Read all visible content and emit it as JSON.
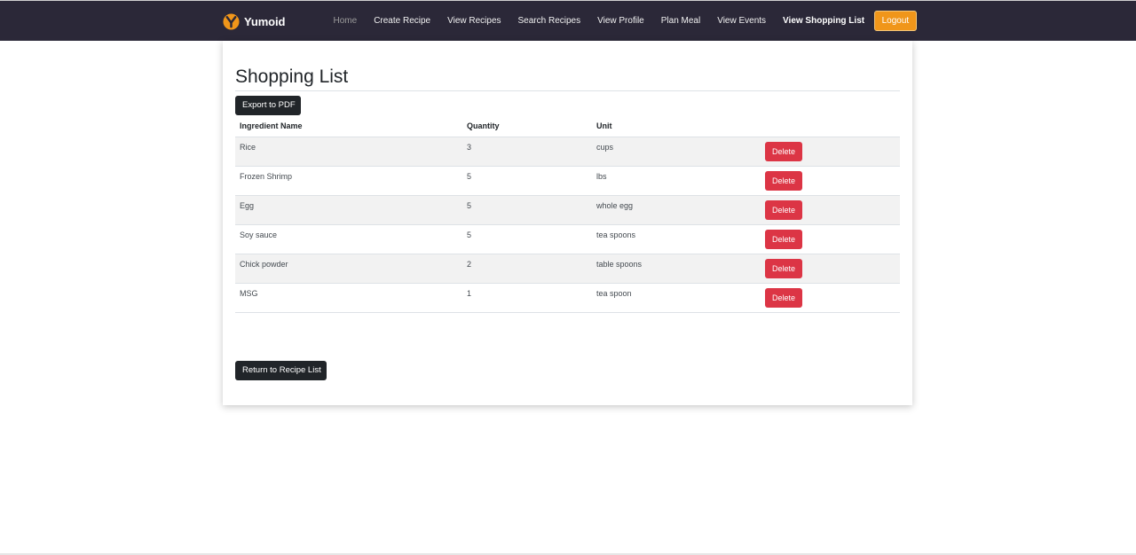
{
  "nav": {
    "brand": "Yumoid",
    "links": [
      {
        "label": "Home"
      },
      {
        "label": "Create Recipe"
      },
      {
        "label": "View Recipes"
      },
      {
        "label": "Search Recipes"
      },
      {
        "label": "View Profile"
      },
      {
        "label": "Plan Meal"
      },
      {
        "label": "View Events"
      },
      {
        "label": "View Shopping List"
      }
    ],
    "logout_label": "Logout",
    "brand_color": "#f0961a",
    "background_color": "#2b2838"
  },
  "page": {
    "title": "Shopping List",
    "export_label": "Export to PDF",
    "return_label": "Return to Recipe List"
  },
  "table": {
    "headers": [
      "Ingredient Name",
      "Quantity",
      "Unit",
      ""
    ],
    "delete_label": "Delete",
    "rows": [
      {
        "name": "Rice",
        "quantity": "3",
        "unit": "cups"
      },
      {
        "name": "Frozen Shrimp",
        "quantity": "5",
        "unit": "lbs"
      },
      {
        "name": "Egg",
        "quantity": "5",
        "unit": "whole egg"
      },
      {
        "name": "Soy sauce",
        "quantity": "5",
        "unit": "tea spoons"
      },
      {
        "name": "Chick powder",
        "quantity": "2",
        "unit": "table spoons"
      },
      {
        "name": "MSG",
        "quantity": "1",
        "unit": "tea spoon"
      }
    ]
  }
}
